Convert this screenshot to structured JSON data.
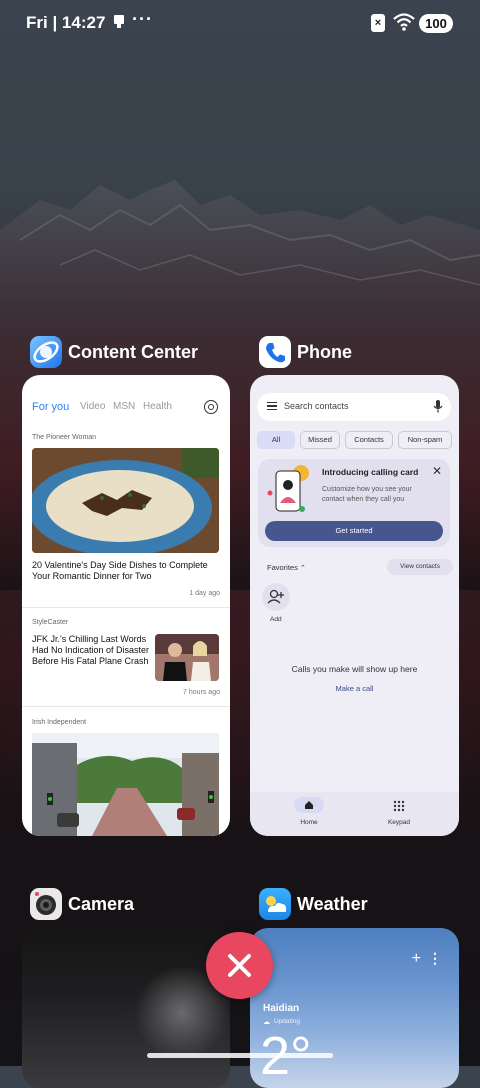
{
  "status_bar": {
    "time": "Fri | 14:27",
    "more": "···",
    "battery": "100"
  },
  "apps": {
    "content_center": {
      "title": "Content Center",
      "tabs": [
        "For you",
        "Video",
        "MSN",
        "Health"
      ],
      "articles": [
        {
          "source": "The Pioneer Woman",
          "headline": "20 Valentine's Day Side Dishes to Complete Your Romantic Dinner for Two",
          "time": "1 day ago"
        },
        {
          "source": "StyleCaster",
          "headline": "JFK Jr.'s Chilling Last Words Had No Indication of Disaster Before His Fatal Plane Crash",
          "time": "7 hours ago"
        },
        {
          "source": "Irish Independent"
        }
      ]
    },
    "phone": {
      "title": "Phone",
      "search_placeholder": "Search contacts",
      "filters": [
        "All",
        "Missed",
        "Contacts",
        "Non-spam"
      ],
      "promo": {
        "title": "Introducing calling card",
        "body": "Customize how you see your contact when they call you",
        "button": "Get started"
      },
      "favorites_label": "Favorites",
      "view_contacts": "View contacts",
      "add_label": "Add",
      "empty_text": "Calls you make will show up here",
      "make_call": "Make a call",
      "nav": [
        "Home",
        "Keypad"
      ]
    },
    "camera": {
      "title": "Camera"
    },
    "weather": {
      "title": "Weather",
      "city": "Haidian",
      "status": "Updating",
      "temp_partial": "2°"
    }
  },
  "colors": {
    "accent_blue": "#2d7ef7",
    "close_button": "#e8475f",
    "phone_button": "#47568f"
  }
}
